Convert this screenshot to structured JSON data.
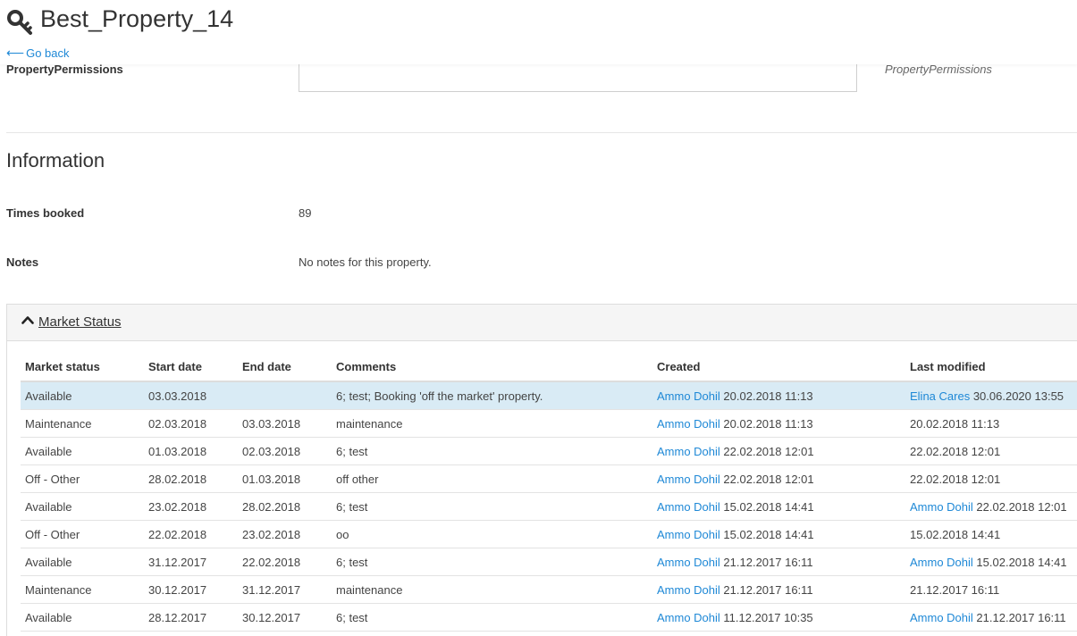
{
  "header": {
    "title": "Best_Property_14",
    "title_icon": "key-icon",
    "go_back_label": "Go back"
  },
  "permissions": {
    "label": "PropertyPermissions",
    "value": "",
    "hint": "PropertyPermissions"
  },
  "information": {
    "title": "Information",
    "times_booked_label": "Times booked",
    "times_booked_value": "89",
    "notes_label": "Notes",
    "notes_value": "No notes for this property."
  },
  "market_status": {
    "panel_title": "Market Status",
    "columns": [
      "Market status",
      "Start date",
      "End date",
      "Comments",
      "Created",
      "Last modified"
    ],
    "rows": [
      {
        "status": "Available",
        "start": "03.03.2018",
        "end": "",
        "comments": "6; test; Booking 'off the market' property.",
        "created_by": "Ammo Dohil",
        "created_at": "20.02.2018 11:13",
        "modified_by": "Elina Cares",
        "modified_at": "30.06.2020 13:55",
        "selected": true
      },
      {
        "status": "Maintenance",
        "start": "02.03.2018",
        "end": "03.03.2018",
        "comments": "maintenance",
        "created_by": "Ammo Dohil",
        "created_at": "20.02.2018 11:13",
        "modified_by": "",
        "modified_at": "20.02.2018 11:13"
      },
      {
        "status": "Available",
        "start": "01.03.2018",
        "end": "02.03.2018",
        "comments": "6; test",
        "created_by": "Ammo Dohil",
        "created_at": "22.02.2018 12:01",
        "modified_by": "",
        "modified_at": "22.02.2018 12:01"
      },
      {
        "status": "Off - Other",
        "start": "28.02.2018",
        "end": "01.03.2018",
        "comments": "off other",
        "created_by": "Ammo Dohil",
        "created_at": "22.02.2018 12:01",
        "modified_by": "",
        "modified_at": "22.02.2018 12:01"
      },
      {
        "status": "Available",
        "start": "23.02.2018",
        "end": "28.02.2018",
        "comments": "6; test",
        "created_by": "Ammo Dohil",
        "created_at": "15.02.2018 14:41",
        "modified_by": "Ammo Dohil",
        "modified_at": "22.02.2018 12:01"
      },
      {
        "status": "Off - Other",
        "start": "22.02.2018",
        "end": "23.02.2018",
        "comments": "oo",
        "created_by": "Ammo Dohil",
        "created_at": "15.02.2018 14:41",
        "modified_by": "",
        "modified_at": "15.02.2018 14:41"
      },
      {
        "status": "Available",
        "start": "31.12.2017",
        "end": "22.02.2018",
        "comments": "6; test",
        "created_by": "Ammo Dohil",
        "created_at": "21.12.2017 16:11",
        "modified_by": "Ammo Dohil",
        "modified_at": "15.02.2018 14:41"
      },
      {
        "status": "Maintenance",
        "start": "30.12.2017",
        "end": "31.12.2017",
        "comments": "maintenance",
        "created_by": "Ammo Dohil",
        "created_at": "21.12.2017 16:11",
        "modified_by": "",
        "modified_at": "21.12.2017 16:11"
      },
      {
        "status": "Available",
        "start": "28.12.2017",
        "end": "30.12.2017",
        "comments": "6; test",
        "created_by": "Ammo Dohil",
        "created_at": "11.12.2017 10:35",
        "modified_by": "Ammo Dohil",
        "modified_at": "21.12.2017 16:11"
      }
    ]
  },
  "colors": {
    "link": "#1e88d6",
    "selected_row": "#d9ebf5",
    "panel_header": "#f5f5f5"
  }
}
